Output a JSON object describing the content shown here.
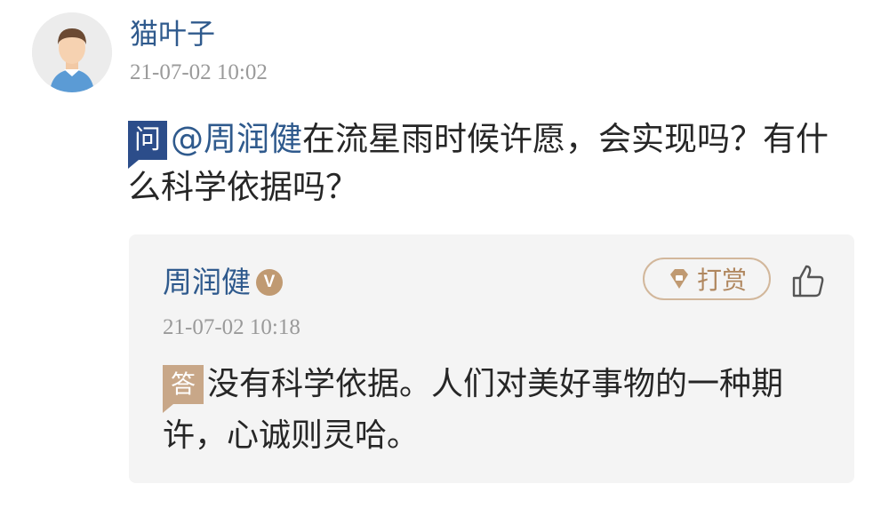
{
  "question_post": {
    "asker_name": "猫叶子",
    "timestamp": "21-07-02 10:02",
    "badge_label": "问",
    "mention": "@周润健",
    "question_text": "在流星雨时候许愿，会实现吗？有什么科学依据吗？"
  },
  "answer_post": {
    "answerer_name": "周润健",
    "verified_badge": "V",
    "tip_label": "打赏",
    "timestamp": "21-07-02 10:18",
    "badge_label": "答",
    "answer_text": "没有科学依据。人们对美好事物的一种期许，心诚则灵哈。"
  },
  "colors": {
    "link_blue": "#2f5a8d",
    "question_badge": "#2c4d8a",
    "answer_badge": "#c8a788",
    "tip_border": "#d2b79b",
    "card_bg": "#f4f4f4",
    "timestamp_gray": "#9a9a9a"
  },
  "icons": {
    "avatar": "user-avatar-icon",
    "tip": "diamond-gift-icon",
    "like": "thumbs-up-icon",
    "verified": "verified-v-icon"
  }
}
